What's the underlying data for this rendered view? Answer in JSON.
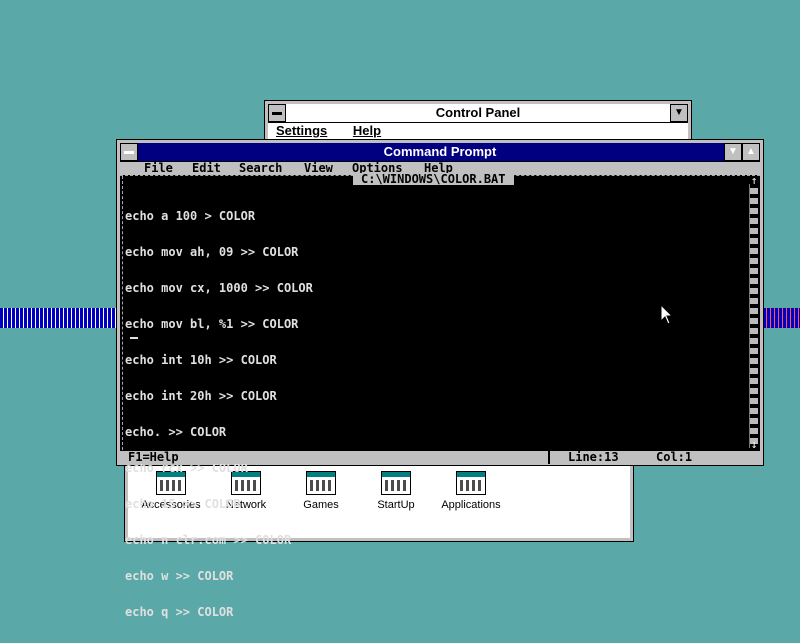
{
  "control_panel": {
    "title": "Control Panel",
    "menu": [
      "Settings",
      "Help"
    ]
  },
  "command_prompt": {
    "title": "Command Prompt",
    "menu": [
      "File",
      "Edit",
      "Search",
      "View",
      "Options",
      "Help"
    ],
    "file_name": "C:\\WINDOWS\\COLOR.BAT",
    "lines": [
      "echo a 100 > COLOR",
      "echo mov ah, 09 >> COLOR",
      "echo mov cx, 1000 >> COLOR",
      "echo mov bl, %1 >> COLOR",
      "echo int 10h >> COLOR",
      "echo int 20h >> COLOR",
      "echo. >> COLOR",
      "echo rcx >> COLOR",
      "echo 15 >> COLOR",
      "echo n clr.com >> COLOR",
      "echo w >> COLOR",
      "echo q >> COLOR"
    ],
    "status": {
      "help": "F1=Help",
      "line": "Line:13",
      "col": "Col:1"
    }
  },
  "program_group": {
    "icons": [
      {
        "label": "Accessories",
        "icon": "program-group-icon"
      },
      {
        "label": "Network",
        "icon": "program-group-icon"
      },
      {
        "label": "Games",
        "icon": "program-group-icon"
      },
      {
        "label": "StartUp",
        "icon": "program-group-icon"
      },
      {
        "label": "Applications",
        "icon": "program-group-icon"
      }
    ]
  },
  "colors": {
    "desktop": "#5aa8a8",
    "title_active": "#000080",
    "terminal_bg": "#000000",
    "terminal_fg": "#e0e0e0"
  }
}
